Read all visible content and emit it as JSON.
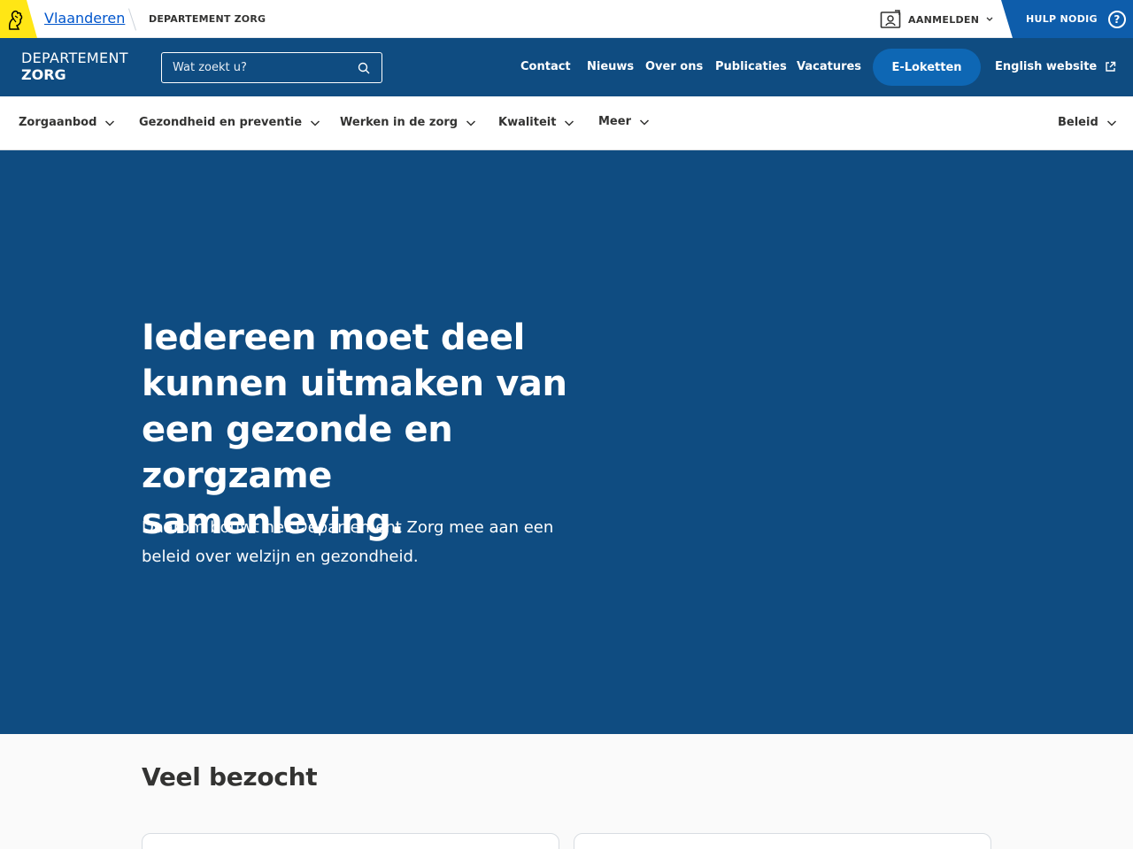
{
  "global_bar": {
    "vlaanderen_link": "Vlaanderen",
    "department": "DEPARTEMENT ZORG",
    "login_label": "AANMELDEN",
    "help_label": "HULP NODIG"
  },
  "header": {
    "brand_line1": "DEPARTEMENT",
    "brand_line2": "ZORG",
    "search_placeholder": "Wat zoekt u?",
    "nav": [
      "Contact",
      "Nieuws",
      "Over ons",
      "Publicaties",
      "Vacatures"
    ],
    "eloket_label": "E-Loketten",
    "english_label": "English website"
  },
  "subnav": {
    "items": [
      "Zorgaanbod",
      "Gezondheid en preventie",
      "Werken in de zorg",
      "Kwaliteit",
      "Meer"
    ],
    "right_item": "Beleid"
  },
  "hero": {
    "title": "Iedereen moet deel kunnen uitmaken van een gezonde en zorgzame samenleving.",
    "subtitle": "Daarom bouwt het Departement Zorg mee aan een beleid over welzijn en gezondheid."
  },
  "visited": {
    "title": "Veel bezocht"
  },
  "colors": {
    "flanders_yellow": "#ffe615",
    "header_blue": "#0f4c81",
    "help_blue": "#0e5dab",
    "eloket_blue": "#0e67b4"
  },
  "icons": {
    "logo": "flemish-lion-icon",
    "login": "id-card-icon",
    "help": "question-circle-icon",
    "search": "search-icon",
    "external": "external-link-icon",
    "dropdown": "chevron-down-icon"
  }
}
